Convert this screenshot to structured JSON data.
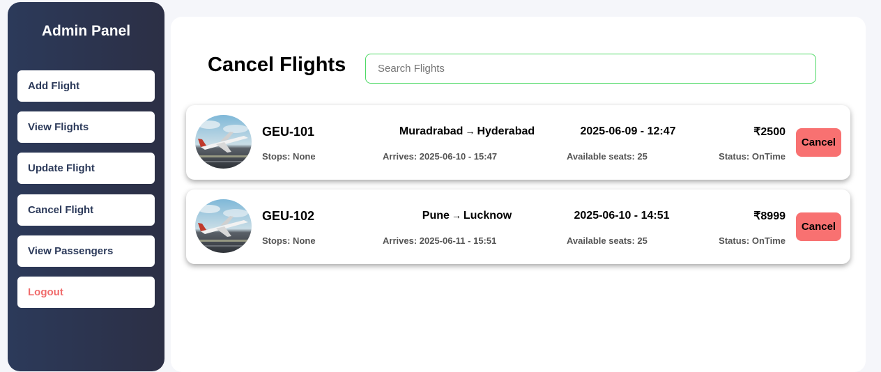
{
  "sidebar": {
    "title": "Admin Panel",
    "items": [
      {
        "label": "Add Flight"
      },
      {
        "label": "View Flights"
      },
      {
        "label": "Update Flight"
      },
      {
        "label": "Cancel Flight"
      },
      {
        "label": "View Passengers"
      },
      {
        "label": "Logout"
      }
    ]
  },
  "main": {
    "title": "Cancel Flights",
    "search": {
      "placeholder": "Search Flights",
      "value": ""
    }
  },
  "flights": [
    {
      "code": "GEU-101",
      "from": "Muradrabad",
      "to": "Hyderabad",
      "arrow": "→",
      "departure": "2025-06-09 - 12:47",
      "price": "₹2500",
      "stops": "Stops: None",
      "arrives": "Arrives: 2025-06-10 - 15:47",
      "seats": "Available seats: 25",
      "status": "Status: OnTime",
      "action": "Cancel"
    },
    {
      "code": "GEU-102",
      "from": "Pune",
      "to": "Lucknow",
      "arrow": "→",
      "departure": "2025-06-10 - 14:51",
      "price": "₹8999",
      "stops": "Stops: None",
      "arrives": "Arrives: 2025-06-11 - 15:51",
      "seats": "Available seats: 25",
      "status": "Status: OnTime",
      "action": "Cancel"
    }
  ],
  "colors": {
    "sidebar_start": "#2c3a5a",
    "sidebar_end": "#2c2f45",
    "cancel_button": "#f87171",
    "logout_text": "#f06c6c",
    "search_border": "#4cd964"
  }
}
